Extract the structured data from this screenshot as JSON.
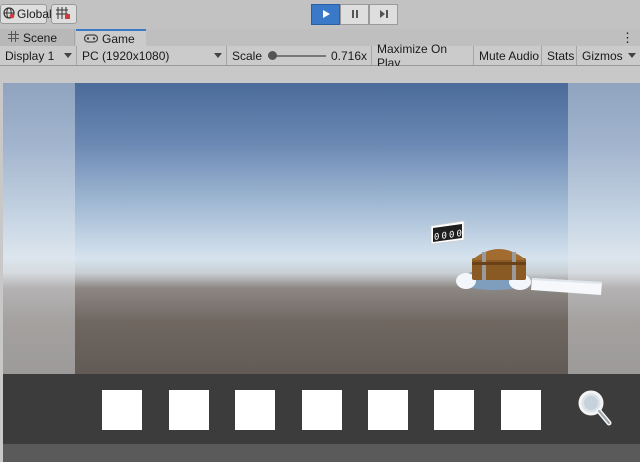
{
  "topbar": {
    "global_label": "Global",
    "global_icon": "globe-icon",
    "grid_icon": "grid-snap-icon",
    "play_icon": "play-icon",
    "pause_icon": "pause-icon",
    "step_icon": "step-icon",
    "accent": "#3a78c8"
  },
  "tabs": [
    {
      "label": "Scene",
      "icon": "grid-icon"
    },
    {
      "label": "Game",
      "icon": "gamepad-icon"
    }
  ],
  "more_label": "⋮",
  "toolbar": {
    "display": "Display 1",
    "resolution": "PC (1920x1080)",
    "scale_label": "Scale",
    "scale_value": "0.716x",
    "maximize": "Maximize On Play",
    "mute": "Mute Audio",
    "stats": "Stats",
    "gizmos": "Gizmos"
  },
  "scene": {
    "counter": [
      "0",
      "0",
      "0",
      "0"
    ]
  },
  "inventory": {
    "slot_count": 7,
    "search_icon": "magnifier-icon"
  }
}
